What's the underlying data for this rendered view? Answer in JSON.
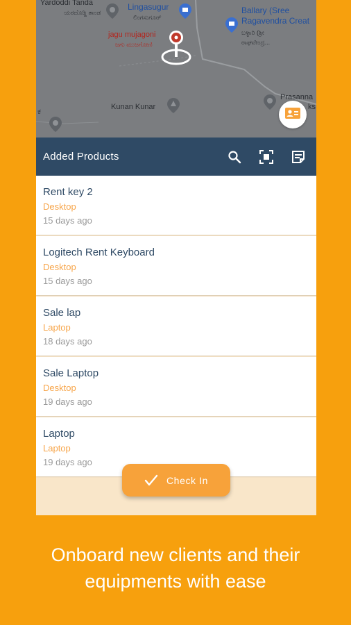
{
  "map": {
    "labels": {
      "yardoddi": "Yardoddi Tanda",
      "yardoddi_kn": "ಯರದೊಡ್ಡಿ ತಾಂಡ",
      "lingasugur": "Lingasugur",
      "lingasugur_kn": "ಲಿಂಗಸುಗೂರ್",
      "ballary_1": "Ballary (Sree",
      "ballary_2": "Ragavendra Creat",
      "ballary_kn_1": "ಬಳ್ಳಾರಿ (ಶ್ರೀ",
      "ballary_kn_2": "ರಾಘವೇಂದ್ರ...",
      "jagu": "jagu mujagoni",
      "jagu_kn": "ಜಗು ಮುಜಗೋಣಿ",
      "kunan": "Kunan Kunar",
      "prasanna_1": "Prasanna",
      "prasanna_2": "ks",
      "left_1": "ಕ"
    },
    "icons": [
      "place-pin-icon",
      "location-marker-icon",
      "contact-card-icon"
    ]
  },
  "toolbar": {
    "title": "Added Products",
    "icons": [
      "search-icon",
      "scan-icon",
      "notes-icon"
    ]
  },
  "products": [
    {
      "name": "Rent key 2",
      "category": "Desktop",
      "time": "15 days ago"
    },
    {
      "name": "Logitech Rent Keyboard",
      "category": "Desktop",
      "time": "15 days ago"
    },
    {
      "name": "Sale lap",
      "category": "Laptop",
      "time": "18 days ago"
    },
    {
      "name": "Sale Laptop",
      "category": "Desktop",
      "time": "19 days ago"
    },
    {
      "name": "Laptop",
      "category": "Laptop",
      "time": "19 days ago"
    }
  ],
  "checkin": {
    "label": "Check In"
  },
  "caption": {
    "line1": "Onboard new clients and their",
    "line2": "equipments with ease"
  },
  "colors": {
    "background": "#f7a00d",
    "toolbar": "#2f4a65",
    "category": "#f7a54a",
    "button": "#f7a23a"
  }
}
